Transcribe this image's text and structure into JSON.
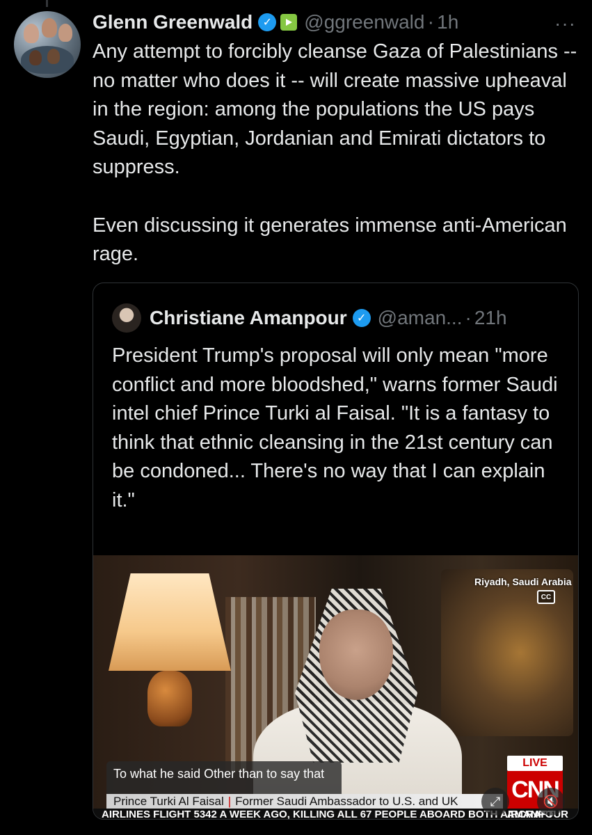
{
  "tweet": {
    "author_name": "Glenn Greenwald",
    "handle": "@ggreenwald",
    "time": "1h",
    "more_label": "···",
    "text": "Any attempt to forcibly cleanse Gaza of Palestinians -- no matter who does it -- will create massive upheaval in the region: among the populations the US pays Saudi, Egyptian, Jordanian and Emirati dictators to suppress.\n\nEven discussing it generates immense anti-American rage."
  },
  "quote": {
    "author_name": "Christiane Amanpour",
    "handle": "@aman...",
    "time": "21h",
    "text": "President Trump's proposal will only mean \"more conflict and more bloodshed,\" warns former Saudi intel chief Prince Turki al Faisal. \"It is a fantasy to think that ethnic cleansing in the 21st century can be condoned... There's no way that I can explain it.\""
  },
  "video": {
    "location": "Riyadh, Saudi Arabia",
    "cc_label": "CC",
    "caption": "To what he said Other than to say that",
    "lower_third_name": "Prince Turki Al Faisal",
    "lower_third_title": "Former Saudi Ambassador to U.S. and UK",
    "ticker": "AIRLINES FLIGHT 5342 A WEEK AGO, KILLING ALL 67 PEOPLE ABOARD BOTH AIRCRAFT",
    "ticker_right": "AMANPOUR",
    "live_label": "LIVE",
    "network_logo": "CNN"
  },
  "colors": {
    "background": "#000000",
    "text": "#e7e9ea",
    "muted": "#71767b",
    "verified": "#1d9bf0",
    "cnn_red": "#cc0000"
  }
}
